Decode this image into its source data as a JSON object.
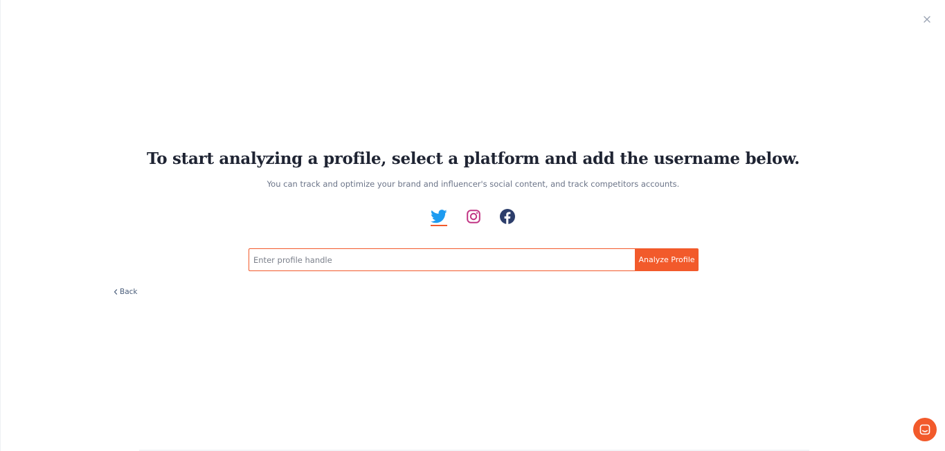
{
  "title": "To start analyzing a profile, select a platform and add the username below.",
  "subtitle": "You can track and optimize your brand and influencer's social content, and track competitors accounts.",
  "platforms": [
    {
      "name": "twitter",
      "icon": "twitter-icon",
      "color": "#1d9bf0",
      "selected": true
    },
    {
      "name": "instagram",
      "icon": "instagram-icon",
      "color": "#c13584",
      "selected": false
    },
    {
      "name": "facebook",
      "icon": "facebook-icon",
      "color": "#2d3e6b",
      "selected": false
    }
  ],
  "search": {
    "value": "",
    "placeholder": "Enter profile handle",
    "button_label": "Analyze Profile"
  },
  "back": {
    "label": "Back",
    "icon": "chevron-left-icon"
  },
  "close_icon": "close-icon",
  "chat_icon": "chat-icon",
  "colors": {
    "accent": "#f25a2b",
    "title": "#1f2433",
    "subtitle": "#6b7488"
  }
}
